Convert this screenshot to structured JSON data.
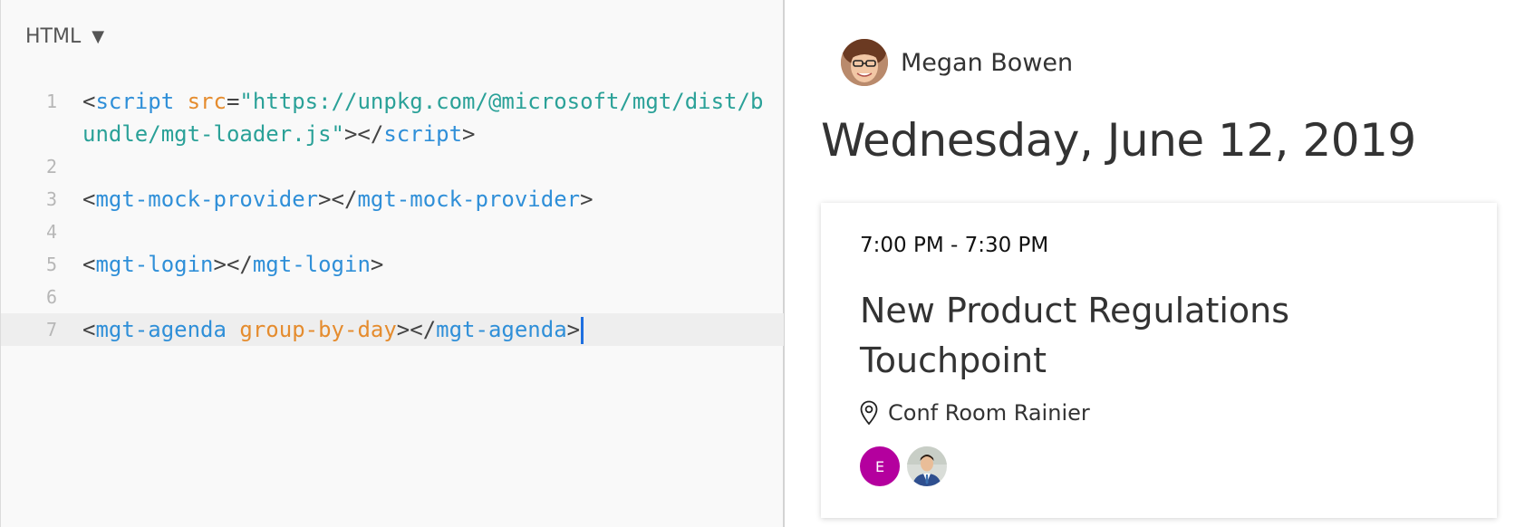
{
  "editor": {
    "language_label": "HTML",
    "caret_icon": "chevron-down-icon",
    "line_numbers": [
      "1",
      "2",
      "3",
      "4",
      "5",
      "6",
      "7"
    ],
    "line1": {
      "open": "<",
      "tag": "script",
      "space": " ",
      "attr": "src",
      "eq": "=",
      "value": "\"https://unpkg.com/@microsoft/mgt/dist/bundle/mgt-loader.js\"",
      "close_open": "></",
      "close_tag": "script",
      "close": ">"
    },
    "line3": {
      "open": "<",
      "tag": "mgt-mock-provider",
      "mid": "></",
      "close_tag": "mgt-mock-provider",
      "close": ">"
    },
    "line5": {
      "open": "<",
      "tag": "mgt-login",
      "mid": "></",
      "close_tag": "mgt-login",
      "close": ">"
    },
    "line7": {
      "open": "<",
      "tag": "mgt-agenda",
      "space": " ",
      "attr": "group-by-day",
      "mid": "></",
      "close_tag": "mgt-agenda",
      "close": ">"
    },
    "colors": {
      "tag": "#2f8fd8",
      "attr": "#e58c2e",
      "string": "#2aa198",
      "cursor": "#1e6fe0"
    }
  },
  "preview": {
    "login": {
      "name": "Megan Bowen",
      "avatar_icon": "user-photo-icon"
    },
    "date_header": "Wednesday, June 12, 2019",
    "event": {
      "time": "7:00 PM - 7:30 PM",
      "title": "New Product Regulations Touchpoint",
      "location_icon": "map-pin-icon",
      "location": "Conf Room Rainier",
      "attendees": [
        {
          "initial": "E",
          "color": "#b4009e"
        },
        {
          "photo_icon": "person-photo-icon"
        }
      ]
    }
  }
}
